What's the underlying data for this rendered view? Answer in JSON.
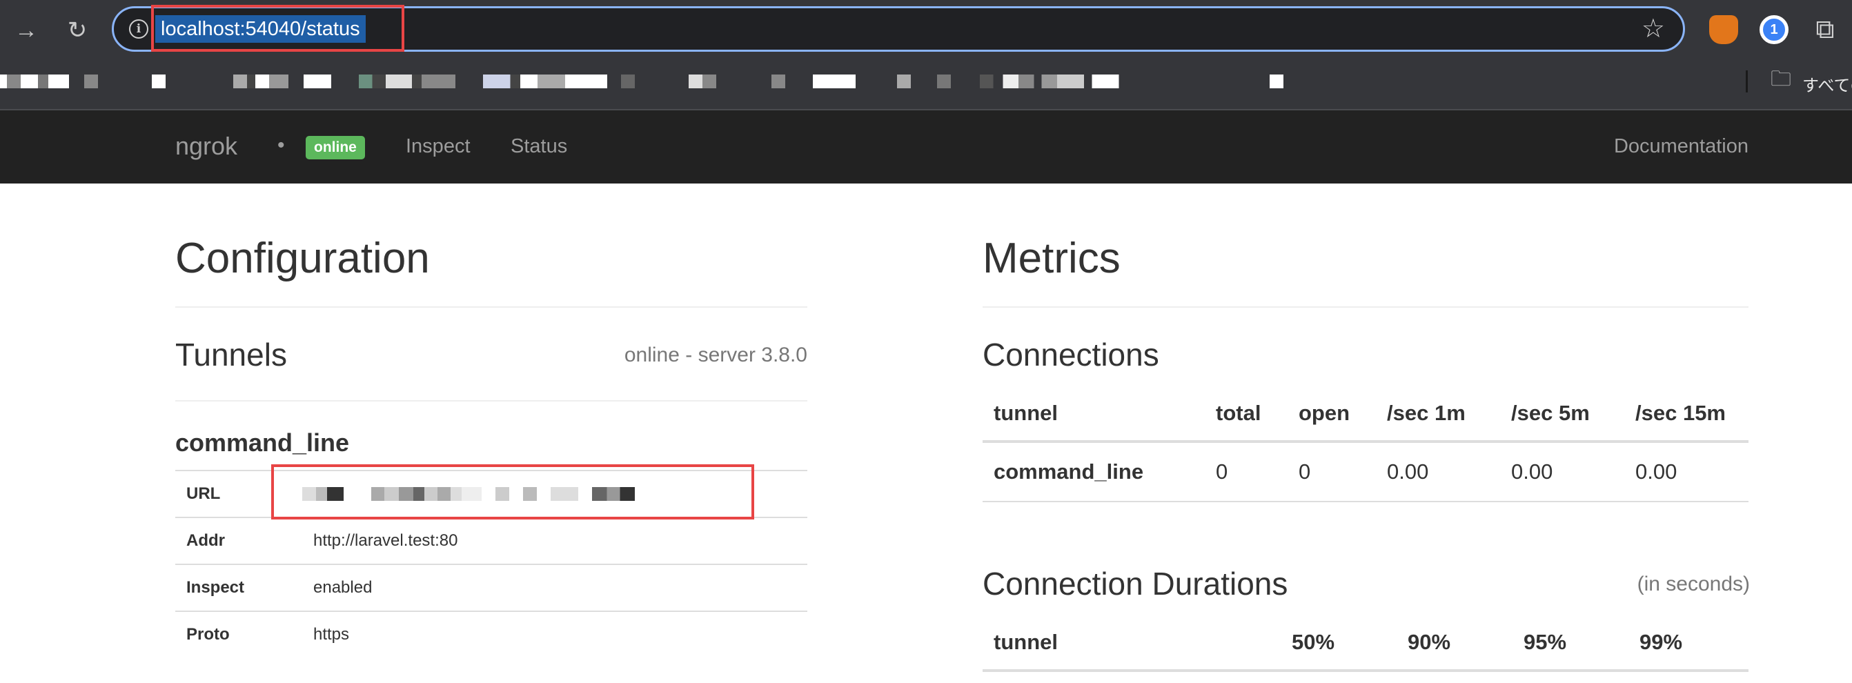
{
  "browser": {
    "address": "localhost:54040/status",
    "bookmarks_other": "すべての"
  },
  "ngrok_nav": {
    "brand": "ngrok",
    "separator": "•",
    "status_badge": "online",
    "links": [
      "Inspect",
      "Status"
    ],
    "documentation": "Documentation"
  },
  "configuration": {
    "title": "Configuration",
    "tunnels_title": "Tunnels",
    "server_status": "online - server 3.8.0",
    "tunnel_name": "command_line",
    "rows": [
      {
        "key": "URL",
        "value": ""
      },
      {
        "key": "Addr",
        "value": "http://laravel.test:80"
      },
      {
        "key": "Inspect",
        "value": "enabled"
      },
      {
        "key": "Proto",
        "value": "https"
      }
    ]
  },
  "metrics": {
    "title": "Metrics",
    "connections": {
      "title": "Connections",
      "headers": [
        "tunnel",
        "total",
        "open",
        "/sec 1m",
        "/sec 5m",
        "/sec 15m"
      ],
      "rows": [
        [
          "command_line",
          "0",
          "0",
          "0.00",
          "0.00",
          "0.00"
        ]
      ]
    },
    "durations": {
      "title": "Connection Durations",
      "unit_note": "(in seconds)",
      "headers": [
        "tunnel",
        "50%",
        "90%",
        "95%",
        "99%"
      ]
    }
  },
  "colors": {
    "online_badge": "#5cb85c",
    "highlight_box": "#e84545",
    "nav_bg": "#222222"
  }
}
